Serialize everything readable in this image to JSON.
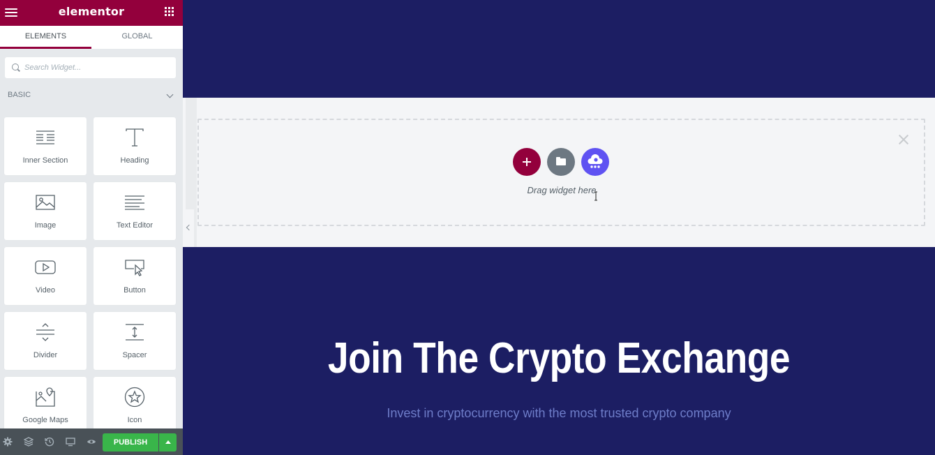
{
  "editor": {
    "brand": "elementor",
    "tabs": [
      {
        "label": "ELEMENTS",
        "active": true
      },
      {
        "label": "GLOBAL",
        "active": false
      }
    ],
    "search": {
      "placeholder": "Search Widget..."
    },
    "category": {
      "label": "BASIC",
      "expanded": true
    },
    "widgets": [
      {
        "label": "Inner Section",
        "icon": "inner-section-icon"
      },
      {
        "label": "Heading",
        "icon": "heading-icon"
      },
      {
        "label": "Image",
        "icon": "image-icon"
      },
      {
        "label": "Text Editor",
        "icon": "text-editor-icon"
      },
      {
        "label": "Video",
        "icon": "video-icon"
      },
      {
        "label": "Button",
        "icon": "button-icon"
      },
      {
        "label": "Divider",
        "icon": "divider-icon"
      },
      {
        "label": "Spacer",
        "icon": "spacer-icon"
      },
      {
        "label": "Google Maps",
        "icon": "google-maps-icon"
      },
      {
        "label": "Icon",
        "icon": "star-icon"
      }
    ],
    "footer": {
      "icons": [
        "settings-icon",
        "navigator-icon",
        "history-icon",
        "responsive-icon",
        "preview-icon"
      ],
      "publish_label": "PUBLISH"
    },
    "colors": {
      "brand": "#93003c",
      "publish": "#39b54a",
      "plugin": "#5f52f2"
    }
  },
  "canvas": {
    "drop_hint": "Drag widget here",
    "hero": {
      "title": "Join The Crypto Exchange",
      "subtitle": "Invest in cryptocurrency with the most trusted crypto company"
    },
    "colors": {
      "background": "#1c1e63",
      "subtitle": "#6e7dc9"
    }
  }
}
